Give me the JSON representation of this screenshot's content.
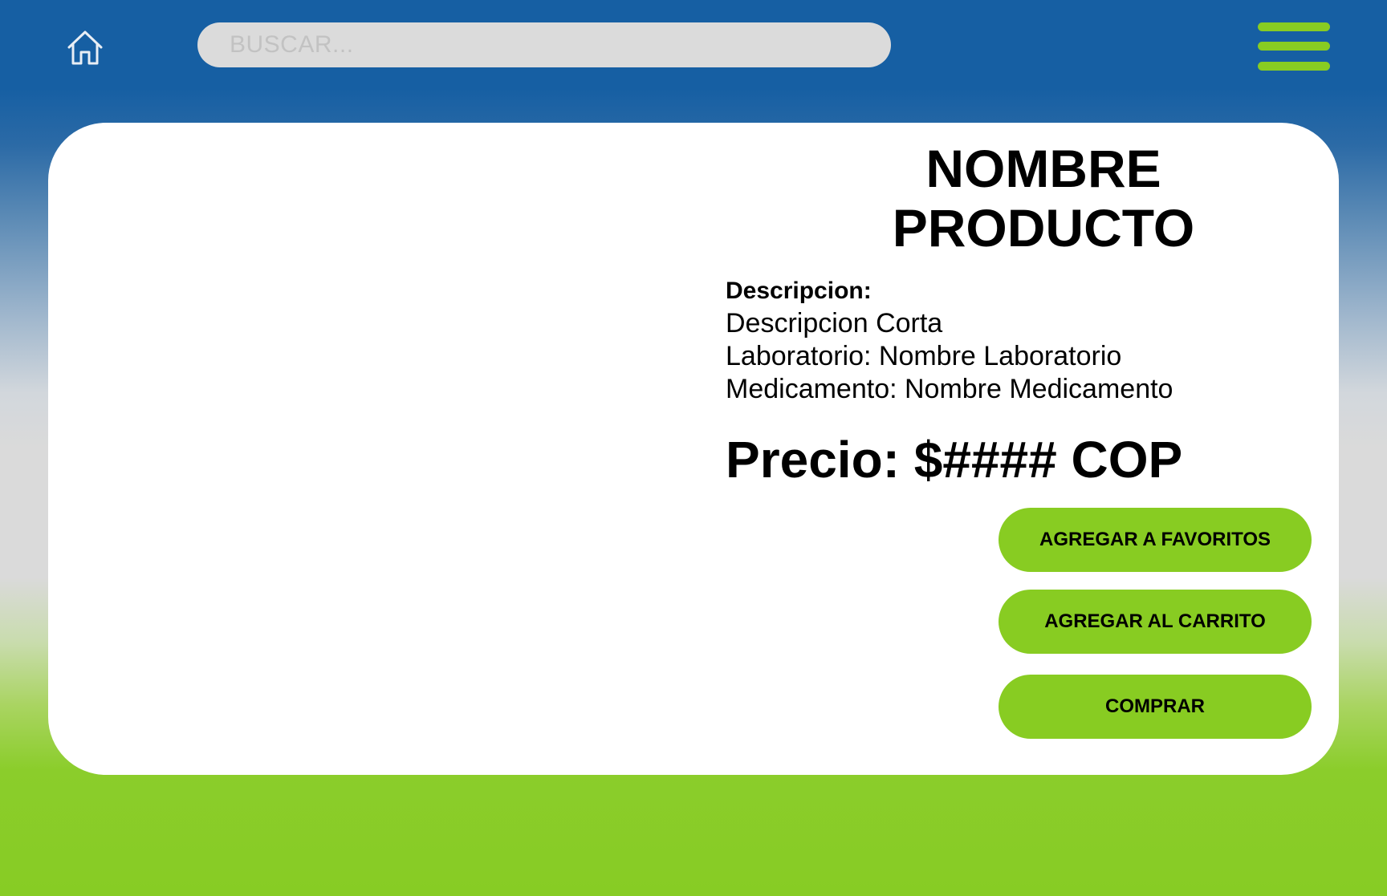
{
  "header": {
    "home_icon": "home-icon",
    "search": {
      "placeholder": "BUSCAR...",
      "value": ""
    },
    "menu_icon": "hamburger-menu-icon"
  },
  "product": {
    "title_line1": "NOMBRE",
    "title_line2": "PRODUCTO",
    "description_heading": "Descripcion:",
    "short_description": "Descripcion Corta",
    "laboratory": "Laboratorio: Nombre Laboratorio",
    "medication": "Medicamento: Nombre Medicamento",
    "price": "Precio: $#### COP"
  },
  "actions": {
    "favorites_label": "AGREGAR A FAVORITOS",
    "cart_label": "AGREGAR AL CARRITO",
    "buy_label": "COMPRAR"
  },
  "colors": {
    "header_blue": "#165fa3",
    "accent_green": "#88cc22",
    "search_bg": "#dbdbdb",
    "card_bg": "#ffffff"
  }
}
